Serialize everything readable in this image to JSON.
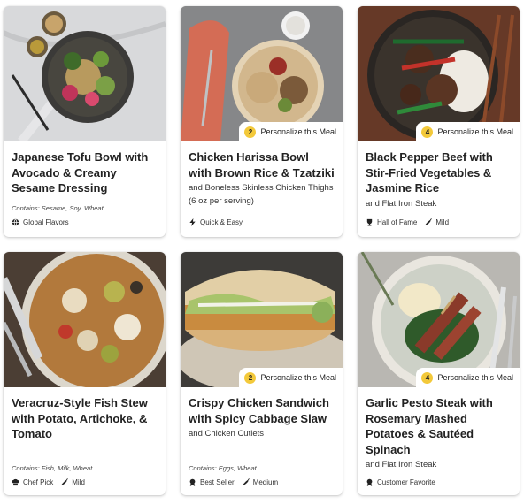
{
  "meals": [
    {
      "title": "Japanese Tofu Bowl with Avocado & Creamy Sesame Dressing",
      "subtitle": "",
      "badge": null,
      "contains": "Contains: Sesame, Soy, Wheat",
      "tags": [
        {
          "icon": "globe-icon",
          "label": "Global Flavors"
        }
      ]
    },
    {
      "title": "Chicken Harissa Bowl with Brown Rice & Tzatziki",
      "subtitle": "and Boneless Skinless Chicken Thighs (6 oz per serving)",
      "badge": {
        "count": "2",
        "label": "Personalize this Meal"
      },
      "contains": "",
      "tags": [
        {
          "icon": "lightning-icon",
          "label": "Quick & Easy"
        }
      ]
    },
    {
      "title": "Black Pepper Beef with Stir-Fried Vegetables & Jasmine Rice",
      "subtitle": "and Flat Iron Steak",
      "badge": {
        "count": "4",
        "label": "Personalize this Meal"
      },
      "contains": "",
      "tags": [
        {
          "icon": "trophy-icon",
          "label": "Hall of Fame"
        },
        {
          "icon": "chili-icon",
          "label": "Mild"
        }
      ]
    },
    {
      "title": "Veracruz-Style Fish Stew with Potato, Artichoke, & Tomato",
      "subtitle": "",
      "badge": null,
      "contains": "Contains: Fish, Milk, Wheat",
      "tags": [
        {
          "icon": "chef-hat-icon",
          "label": "Chef Pick"
        },
        {
          "icon": "chili-icon",
          "label": "Mild"
        }
      ]
    },
    {
      "title": "Crispy Chicken Sandwich with Spicy Cabbage Slaw",
      "subtitle": "and Chicken Cutlets",
      "badge": {
        "count": "2",
        "label": "Personalize this Meal"
      },
      "contains": "Contains: Eggs, Wheat",
      "tags": [
        {
          "icon": "medal-icon",
          "label": "Best Seller"
        },
        {
          "icon": "chili-icon",
          "label": "Medium"
        }
      ]
    },
    {
      "title": "Garlic Pesto Steak with Rosemary Mashed Potatoes & Sautéed Spinach",
      "subtitle": "and Flat Iron Steak",
      "badge": {
        "count": "4",
        "label": "Personalize this Meal"
      },
      "contains": "",
      "tags": [
        {
          "icon": "medal-icon",
          "label": "Customer Favorite"
        }
      ]
    }
  ],
  "colors": {
    "badge_circle": "#f3c93a",
    "card_bg": "#ffffff",
    "text": "#222222"
  }
}
